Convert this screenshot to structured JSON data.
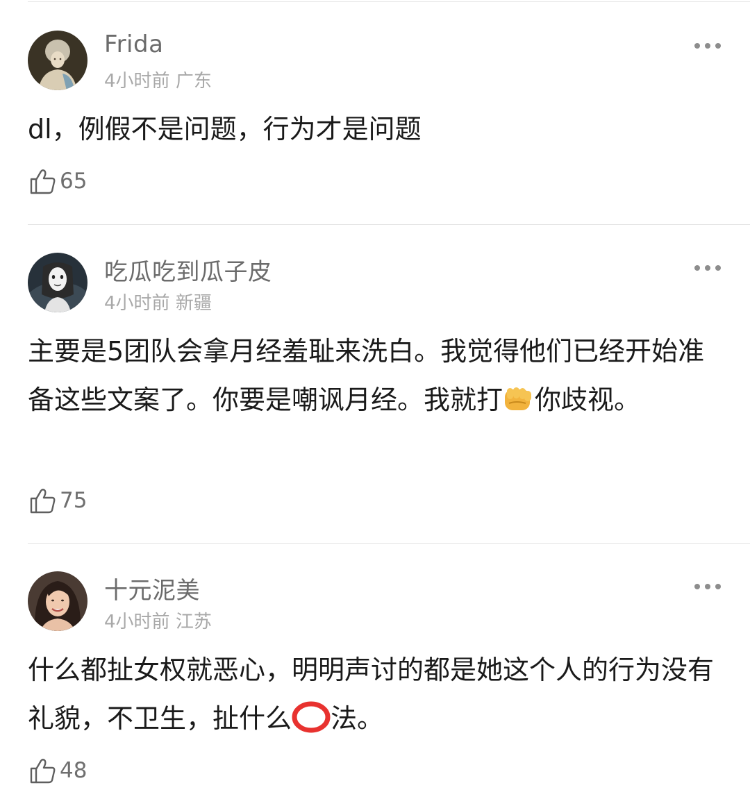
{
  "comments": [
    {
      "username": "Frida",
      "time": "4小时前",
      "location": "广东",
      "text_parts": [
        "dl，例假不是问题，行为才是问题"
      ],
      "likes": "65",
      "avatar_icon": "portrait-avatar"
    },
    {
      "username": "吃瓜吃到瓜子皮",
      "time": "4小时前",
      "location": "新疆",
      "text_parts": [
        "主要是5团队会拿月经羞耻来洗白。我觉得他们已经开始准备这些文案了。你要是嘲讽月经。我就打",
        "你歧视。"
      ],
      "emoji": "fist-emoji",
      "likes": "75",
      "avatar_icon": "masked-character-avatar"
    },
    {
      "username": "十元泥美",
      "time": "4小时前",
      "location": "江苏",
      "text_parts": [
        "什么都扯女权就恶心，明明声讨的都是她这个人的行为没有礼貌，不卫生，扯什么",
        "法。"
      ],
      "emoji": "red-circle-emoji",
      "likes": "48",
      "avatar_icon": "woman-photo-avatar"
    }
  ],
  "icons": {
    "more": "more-dots-icon",
    "like": "thumbs-up-icon"
  },
  "colors": {
    "username": "#6b6b6b",
    "meta": "#a8a8a8",
    "text": "#1a1a1a",
    "divider": "#e3e3e3"
  }
}
